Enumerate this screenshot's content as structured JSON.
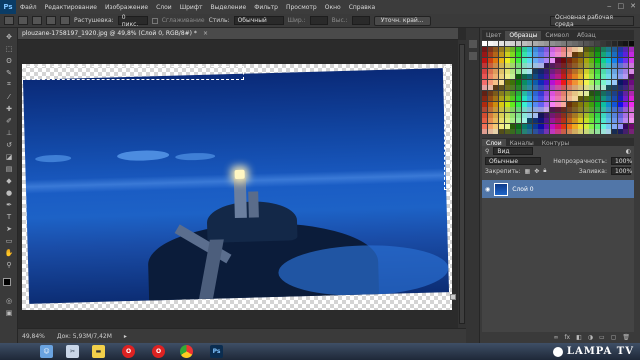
{
  "app": {
    "logo": "Ps"
  },
  "menu": [
    "Файл",
    "Редактирование",
    "Изображение",
    "Слои",
    "Шрифт",
    "Выделение",
    "Фильтр",
    "Просмотр",
    "Окно",
    "Справка"
  ],
  "options": {
    "feather_label": "Растушевка:",
    "feather_value": "0 пикс.",
    "antialias_label": "Сглаживание",
    "style_label": "Стиль:",
    "style_value": "Обычный",
    "width_label": "Шир.:",
    "height_label": "Выс.:",
    "refine_button": "Уточн. край...",
    "workspace": "Основная рабочая среда"
  },
  "document": {
    "tab_title": "plouzane-1758197_1920.jpg @ 49,8% (Слой 0, RGB/8#) *",
    "close": "×"
  },
  "status": {
    "zoom": "49,84%",
    "doc_size": "Док: 5,93M/7,42M"
  },
  "swatch_panel": {
    "tabs": [
      "Цвет",
      "Образцы",
      "Символ",
      "Абзац"
    ],
    "active": 1
  },
  "layers_panel": {
    "tabs": [
      "Слои",
      "Каналы",
      "Контуры"
    ],
    "kind_label": "Вид",
    "blend_mode": "Обычные",
    "opacity_label": "Непрозрачность:",
    "opacity_value": "100%",
    "lock_label": "Закрепить:",
    "fill_label": "Заливка:",
    "fill_value": "100%",
    "layer_name": "Слой 0"
  },
  "brand": {
    "text": "LAMPA TV"
  },
  "colors": {
    "accent": "#5176a8",
    "sea": "#1a5cc4",
    "sky": "#0a2a78"
  }
}
